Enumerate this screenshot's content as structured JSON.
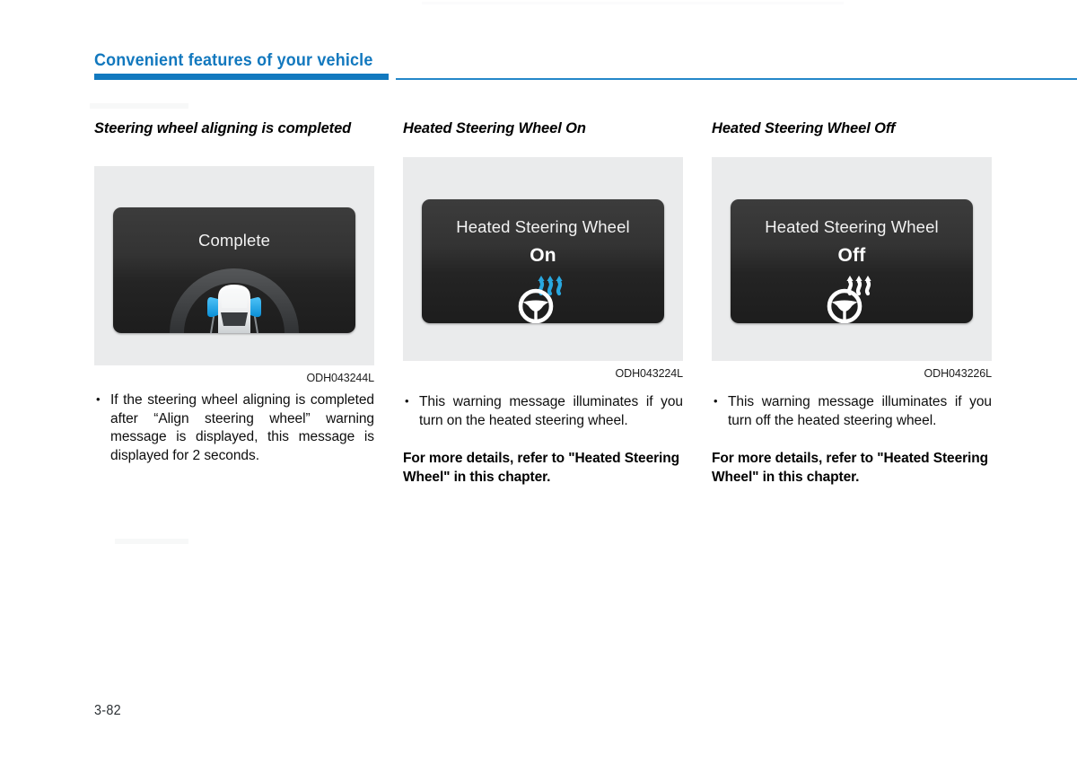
{
  "header": {
    "title": "Convenient features of your vehicle",
    "accent_color": "#1279bf",
    "rule_thin_color": "#2487c9"
  },
  "columns": [
    {
      "heading": "Steering wheel aligning is completed",
      "figure": {
        "caption": "ODH043244L",
        "display_line1": "Complete",
        "display_line2": "",
        "icon": "car-rear-align-icon",
        "accent_color": "#2aa8e8"
      },
      "bullet": "If the steering wheel aligning is completed after “Align steering wheel” warning message is displayed, this message is displayed for 2 seconds.",
      "note": ""
    },
    {
      "heading": "Heated Steering Wheel On",
      "figure": {
        "caption": "ODH043224L",
        "display_line1": "Heated Steering Wheel",
        "display_line2": "On",
        "icon": "heated-steering-wheel-icon",
        "accent_color": "#29a8e0"
      },
      "bullet": "This warning message illuminates if you turn on the heated steering wheel.",
      "note": "For more details, refer to \"Heated Steering Wheel\" in this chapter."
    },
    {
      "heading": "Heated Steering Wheel Off",
      "figure": {
        "caption": "ODH043226L",
        "display_line1": "Heated Steering Wheel",
        "display_line2": "Off",
        "icon": "heated-steering-wheel-icon",
        "accent_color": "#ffffff"
      },
      "bullet": "This warning message illuminates if you turn off the heated steering wheel.",
      "note": "For more details, refer to \"Heated Steering Wheel\" in this chapter."
    }
  ],
  "footer": {
    "page_number": "3-82"
  }
}
